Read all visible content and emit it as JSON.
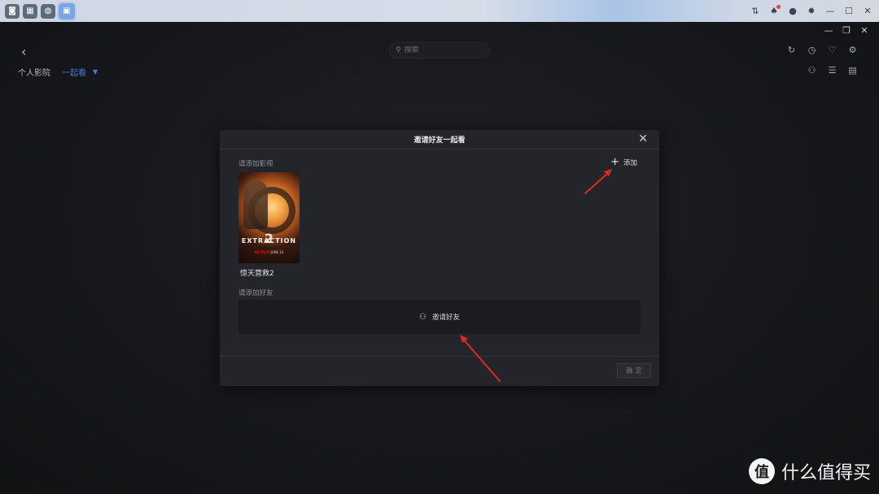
{
  "os_bar": {
    "left_icons": [
      "camera-icon",
      "apps-grid-icon",
      "globe-icon",
      "tv-app-icon"
    ],
    "right_icons": [
      "control-icon",
      "notification-bell-icon",
      "user-icon",
      "gear-icon",
      "minimize-icon",
      "maximize-icon",
      "close-icon"
    ]
  },
  "app": {
    "window_controls": [
      "minimize-icon",
      "restore-icon",
      "close-icon"
    ],
    "search": {
      "placeholder": "搜索"
    },
    "top_tools": [
      "refresh-icon",
      "history-icon",
      "favorite-icon",
      "settings-icon"
    ],
    "nav": {
      "item1": "个人影院",
      "item2": "一起看",
      "caret": "▼"
    },
    "sub_tools": [
      "add-user-icon",
      "sort-list-icon",
      "chart-icon"
    ]
  },
  "modal": {
    "title": "邀请好友一起看",
    "section_movies": "请添加影视",
    "add_label": "添加",
    "movie": {
      "name": "惊天营救2",
      "poster_title": "EXTRACTION",
      "poster_number": "2",
      "poster_brand": "NETFLIX",
      "poster_date": "JUNE 16"
    },
    "section_friends": "请添加好友",
    "invite_label": "邀请好友",
    "confirm_label": "确 定"
  },
  "watermark": {
    "logo_char": "值",
    "text": "什么值得买"
  },
  "colors": {
    "accent": "#3f7fe3",
    "annotation_arrow": "#e02a20"
  }
}
